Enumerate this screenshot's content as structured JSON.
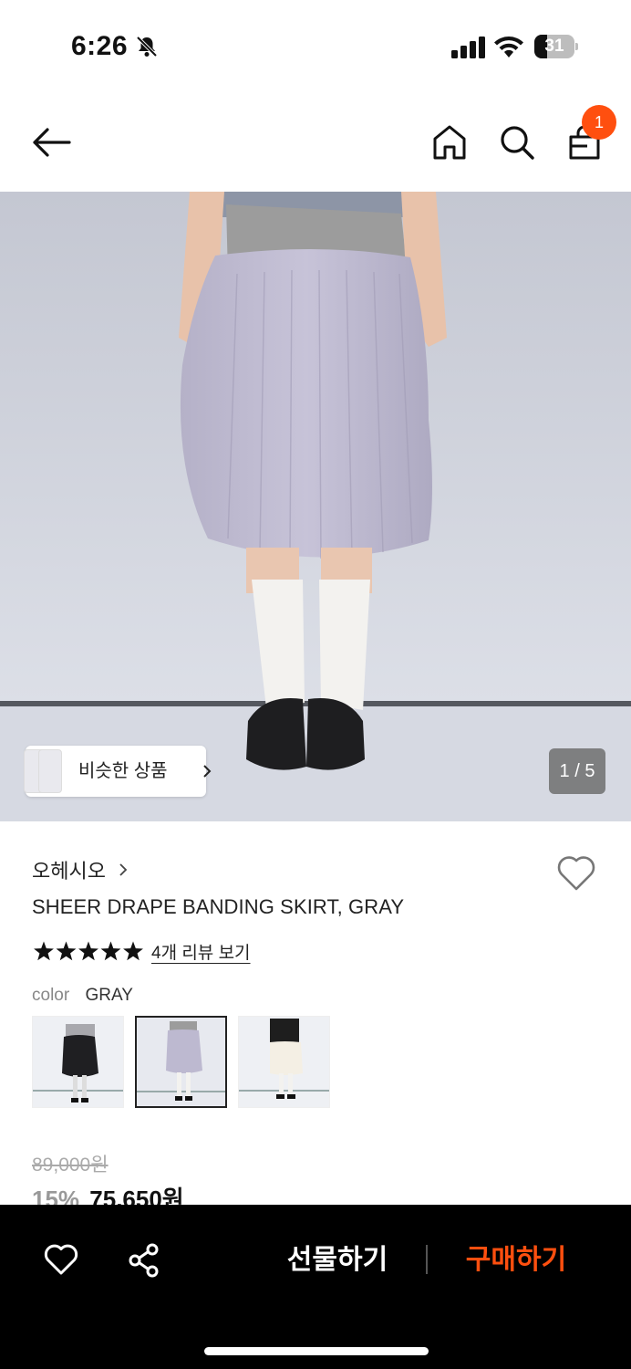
{
  "status_bar": {
    "time": "6:26",
    "battery": "31",
    "battery_level_percent": 31,
    "icons": [
      "bell-slash-icon",
      "signal-icon",
      "wifi-icon",
      "battery-icon"
    ]
  },
  "header": {
    "icons": [
      "back-arrow-icon",
      "home-icon",
      "search-icon",
      "shopping-bag-icon"
    ],
    "cart_count": "1"
  },
  "gallery": {
    "similar_label": "비슷한 상품",
    "counter": "1 / 5"
  },
  "product": {
    "brand": "오헤시오",
    "title": "SHEER DRAPE BANDING SKIRT, GRAY",
    "rating_stars": 5,
    "review_link": "4개 리뷰 보기",
    "color_label": "color",
    "color_value": "GRAY",
    "original_price": "89,000원",
    "discount": "15%",
    "final_price": "75,650원"
  },
  "bottom_bar": {
    "icons": [
      "heart-icon",
      "share-icon"
    ],
    "gift_label": "선물하기",
    "buy_label": "구매하기"
  },
  "colors": {
    "accent": "#ff4f0f",
    "bar_background": "#000000"
  }
}
